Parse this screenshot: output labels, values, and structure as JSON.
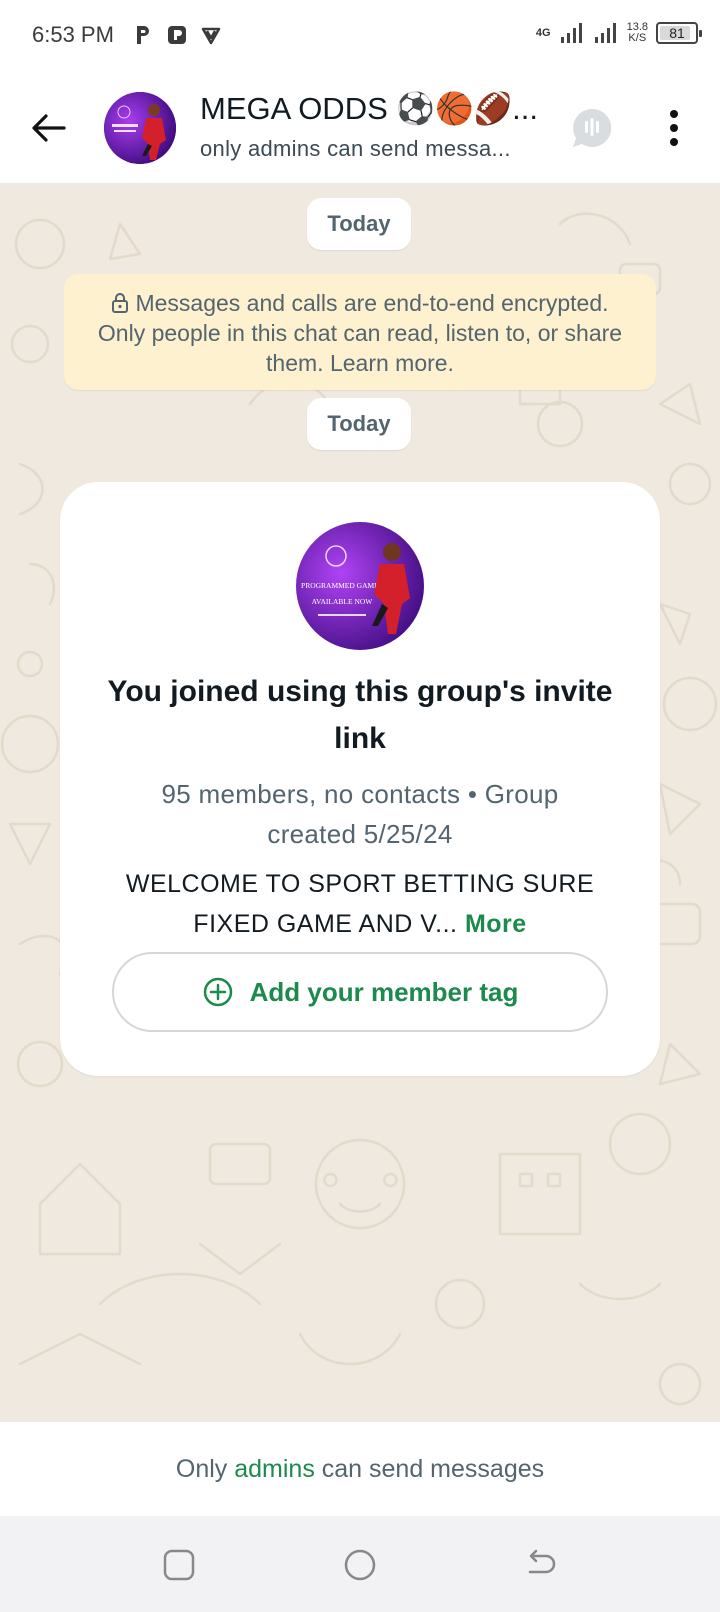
{
  "status_bar": {
    "time": "6:53 PM",
    "network": "4G",
    "speed_value": "13.8",
    "speed_unit": "K/S",
    "battery": "81"
  },
  "header": {
    "title": "MEGA ODDS ⚽🏀🏈...",
    "subtitle": "only admins can send messa..."
  },
  "chat": {
    "date_chip_1": "Today",
    "encryption_notice": "Messages and calls are end-to-end encrypted. Only people in this chat can read, listen to, or share them. Learn more.",
    "date_chip_2": "Today",
    "card": {
      "title": "You joined using this group's invite link",
      "meta": "95 members, no contacts • Group created 5/25/24",
      "description": "WELCOME TO SPORT BETTING SURE FIXED GAME AND V...",
      "more_label": "More",
      "tag_button_label": "Add your member tag",
      "avatar_caption_1": "PROGRAMMED GAMES",
      "avatar_caption_2": "AVAILABLE NOW"
    }
  },
  "footer": {
    "prefix": "Only ",
    "link": "admins",
    "suffix": " can send messages"
  },
  "colors": {
    "accent_green": "#1d8a4d",
    "chat_bg": "#efe9df",
    "encryption_bg": "#fdf1cf"
  }
}
